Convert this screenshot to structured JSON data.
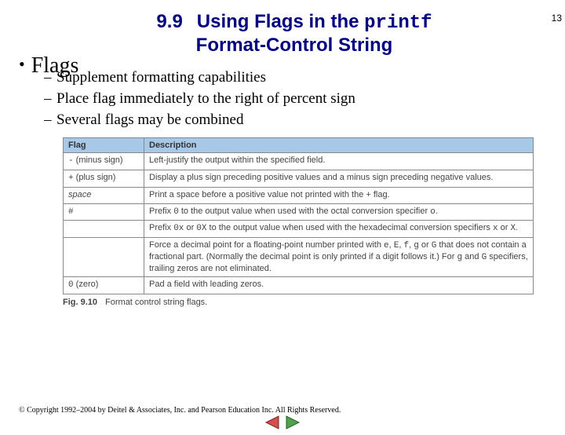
{
  "page_number": "13",
  "title": {
    "section_number": "9.9",
    "line1_prefix": "Using Flags in the ",
    "line1_code": "printf",
    "line2": "Format-Control String"
  },
  "main_bullet": "Flags",
  "sub_bullets": [
    "Supplement formatting capabilities",
    "Place flag immediately to the right of percent sign",
    "Several flags may be combined"
  ],
  "table": {
    "headers": [
      "Flag",
      "Description"
    ],
    "rows": [
      {
        "flag_sym": "-",
        "flag_note": " (minus sign)",
        "desc": "Left-justify the output within the specified field."
      },
      {
        "flag_sym": "+",
        "flag_note": " (plus sign)",
        "desc": "Display a plus sign preceding positive values and a minus sign preceding negative values."
      },
      {
        "flag_italic": "space",
        "desc": "Print a space before a positive value not printed with the + flag."
      },
      {
        "flag_sym": "#",
        "desc_parts": [
          "Prefix ",
          {
            "mono": "0"
          },
          " to the output value when used with the octal conversion specifier ",
          {
            "mono": "o"
          },
          "."
        ]
      },
      {
        "flag_sym": "",
        "desc_parts": [
          "Prefix ",
          {
            "mono": "0x"
          },
          " or ",
          {
            "mono": "0X"
          },
          " to the output value when used with the hexadecimal conversion specifiers ",
          {
            "mono": "x"
          },
          " or ",
          {
            "mono": "X"
          },
          "."
        ]
      },
      {
        "flag_sym": "",
        "desc_parts": [
          "Force a decimal point for a floating-point number printed with ",
          {
            "mono": "e"
          },
          ", ",
          {
            "mono": "E"
          },
          ", ",
          {
            "mono": "f"
          },
          ", ",
          {
            "mono": "g"
          },
          " or ",
          {
            "mono": "G"
          },
          " that does not contain a fractional part. (Normally the decimal point is only printed if a digit follows it.) For ",
          {
            "mono": "g"
          },
          " and ",
          {
            "mono": "G"
          },
          " specifiers, trailing zeros are not eliminated."
        ]
      },
      {
        "flag_sym": "0",
        "flag_note": " (zero)",
        "desc": "Pad a field with leading zeros."
      }
    ]
  },
  "figure_caption": {
    "fig": "Fig. 9.10",
    "text": "Format control string flags."
  },
  "copyright": "© Copyright 1992–2004 by Deitel & Associates, Inc. and Pearson Education Inc. All Rights Reserved.",
  "nav": {
    "prev": "prev-slide",
    "next": "next-slide"
  }
}
